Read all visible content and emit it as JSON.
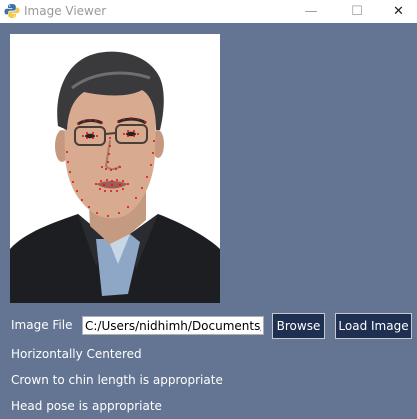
{
  "window": {
    "title": "Image Viewer",
    "minimize": "—",
    "maximize": "☐",
    "close": "✕"
  },
  "colors": {
    "background": "#637592",
    "button": "#1e2f52"
  },
  "image_file": {
    "label": "Image File",
    "value": "C:/Users/nidhimh/Documents/c"
  },
  "buttons": {
    "browse": "Browse",
    "load_image": "Load Image"
  },
  "results": [
    "Horizontally Centered",
    "Crown to chin length is appropriate",
    "Head pose is appropriate"
  ]
}
